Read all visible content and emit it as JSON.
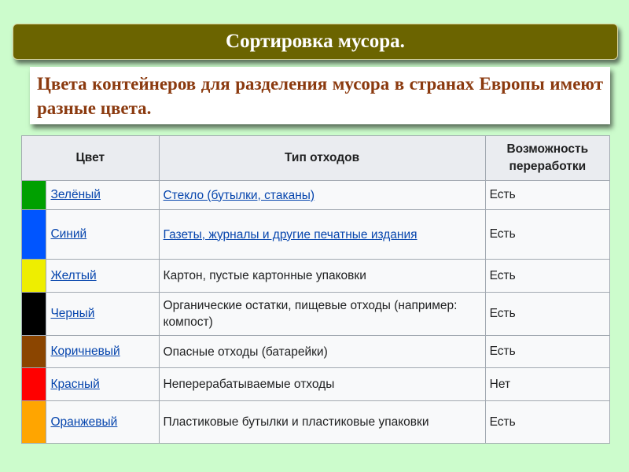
{
  "title": "Сортировка мусора.",
  "intro": "Цвета контейнеров для разделения мусора в странах Европы имеют разные цвета.",
  "table": {
    "headers": [
      "Цвет",
      "Тип отходов",
      "Возможность переработки"
    ],
    "rows": [
      {
        "swatch": "#00a000",
        "name": "Зелёный",
        "type": "Стекло (бутылки, стаканы)",
        "type_link": true,
        "recyclable": "Есть",
        "h": 37
      },
      {
        "swatch": "#0055ff",
        "name": "Синий",
        "type": "Газеты, журналы и другие печатные издания",
        "type_link": true,
        "recyclable": "Есть",
        "h": 63
      },
      {
        "swatch": "#eeee00",
        "name": "Желтый",
        "type": "Картон, пустые картонные упаковки",
        "type_link": false,
        "recyclable": "Есть",
        "h": 42
      },
      {
        "swatch": "#000000",
        "name": "Черный",
        "type": "Органические остатки, пищевые отходы (например: компост)",
        "type_link": false,
        "recyclable": "Есть",
        "h": 55
      },
      {
        "swatch": "#8b4500",
        "name": "Коричневый",
        "type": "Опасные отходы (батарейки)",
        "type_link": false,
        "recyclable": "Есть",
        "h": 41
      },
      {
        "swatch": "#ff0000",
        "name": "Красный",
        "type": "Неперерабатываемые отходы",
        "type_link": false,
        "recyclable": "Нет",
        "h": 42
      },
      {
        "swatch": "#ffa500",
        "name": "Оранжевый",
        "type": "Пластиковые бутылки и пластиковые упаковки",
        "type_link": false,
        "recyclable": "Есть",
        "h": 54
      }
    ]
  }
}
